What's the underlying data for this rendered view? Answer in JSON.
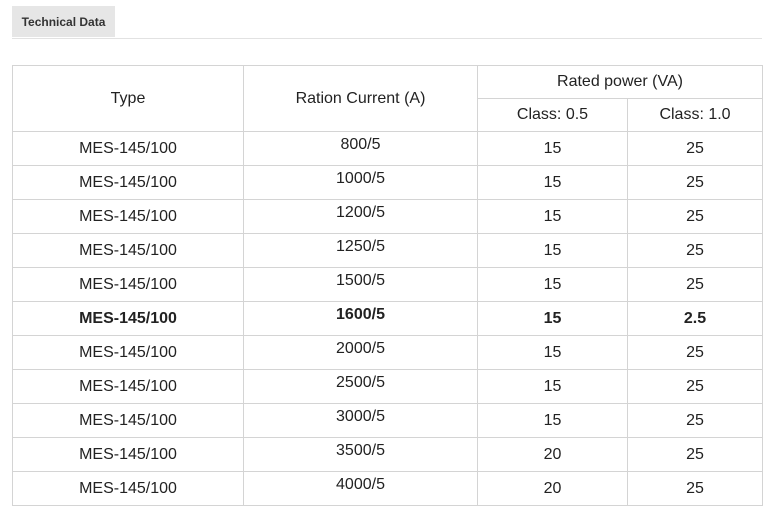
{
  "tab": {
    "label": "Technical Data"
  },
  "table": {
    "headers": {
      "type": "Type",
      "current": "Ration Current (A)",
      "power_group": "Rated power (VA)",
      "class_05": "Class: 0.5",
      "class_10": "Class: 1.0"
    },
    "rows": [
      {
        "type": "MES-145/100",
        "current": "800/5",
        "class_05": "15",
        "class_10": "25",
        "bold": false
      },
      {
        "type": "MES-145/100",
        "current": "1000/5",
        "class_05": "15",
        "class_10": "25",
        "bold": false
      },
      {
        "type": "MES-145/100",
        "current": "1200/5",
        "class_05": "15",
        "class_10": "25",
        "bold": false
      },
      {
        "type": "MES-145/100",
        "current": "1250/5",
        "class_05": "15",
        "class_10": "25",
        "bold": false
      },
      {
        "type": "MES-145/100",
        "current": "1500/5",
        "class_05": "15",
        "class_10": "25",
        "bold": false
      },
      {
        "type": "MES-145/100",
        "current": "1600/5",
        "class_05": "15",
        "class_10": "2.5",
        "bold": true
      },
      {
        "type": "MES-145/100",
        "current": "2000/5",
        "class_05": "15",
        "class_10": "25",
        "bold": false
      },
      {
        "type": "MES-145/100",
        "current": "2500/5",
        "class_05": "15",
        "class_10": "25",
        "bold": false
      },
      {
        "type": "MES-145/100",
        "current": "3000/5",
        "class_05": "15",
        "class_10": "25",
        "bold": false
      },
      {
        "type": "MES-145/100",
        "current": "3500/5",
        "class_05": "20",
        "class_10": "25",
        "bold": false
      },
      {
        "type": "MES-145/100",
        "current": "4000/5",
        "class_05": "20",
        "class_10": "25",
        "bold": false
      }
    ]
  }
}
